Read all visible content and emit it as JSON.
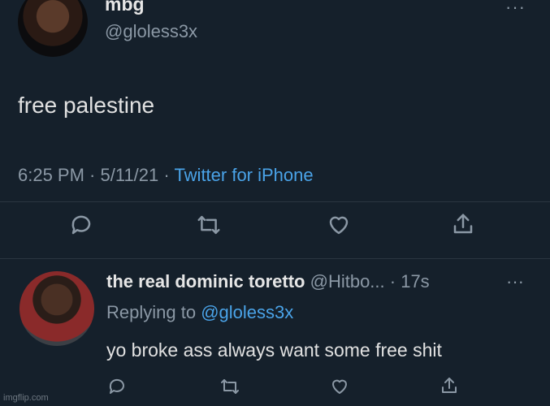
{
  "top_tweet": {
    "name": "mbg",
    "handle": "@gloless3x",
    "more": "···",
    "text": "free palestine",
    "time": "6:25 PM",
    "sep1": " · ",
    "date": "5/11/21",
    "sep2": " · ",
    "source": "Twitter for iPhone"
  },
  "reply": {
    "name": "the real dominic toretto",
    "handle": "@Hitbo...",
    "time": "· 17s",
    "more": "···",
    "replying_label": "Replying to",
    "replying_to": "@gloless3x",
    "text": "yo broke ass always want some free shit"
  },
  "icons": {
    "top_actions": [
      "reply-icon",
      "retweet-icon",
      "like-icon",
      "share-icon"
    ],
    "reply_actions": [
      "reply-icon",
      "retweet-icon",
      "like-icon",
      "share-icon"
    ]
  },
  "colors": {
    "background": "#15202b",
    "accent": "#4aa3e8",
    "secondary_text": "#8b98a5"
  },
  "watermark": "imgflip.com"
}
